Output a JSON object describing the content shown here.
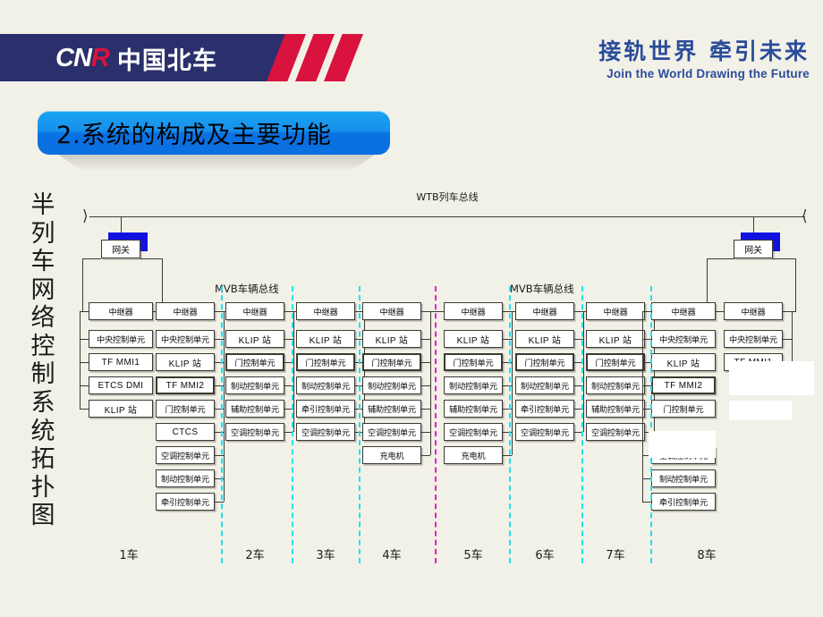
{
  "header": {
    "logo_mark": "CNR",
    "logo_mark_accent": "R",
    "logo_cn": "中国北车",
    "slogan_cn": "接轨世界  牵引未来",
    "slogan_en": "Join the World    Drawing the Future",
    "brand_navy": "#2b2f6b",
    "brand_red": "#d9123e",
    "slogan_color": "#2b4c9b"
  },
  "title": {
    "text": "2.系统的构成及主要功能",
    "accent": "#0b74e4"
  },
  "vertical_caption": "半列车网络控制系统拓扑图",
  "diagram": {
    "train_bus_label": "WTB列车总线",
    "vehicle_bus_label_left": "MVB车辆总线",
    "vehicle_bus_label_right": "MVB车辆总线",
    "gateway_label": "网关",
    "repeater_label": "中继器",
    "divider_color": "#19e3ef",
    "divider_color_mid": "#ef19c7",
    "car_labels": [
      "1车",
      "2车",
      "3车",
      "4车",
      "5车",
      "6车",
      "7车",
      "8车"
    ],
    "columns": [
      {
        "id": "c1a",
        "car": "1车",
        "repeater": "中继器",
        "units": [
          "中央控制单元",
          "TF MMI1",
          "ETCS DMI",
          "KLIP 站"
        ],
        "bold": []
      },
      {
        "id": "c1b",
        "car": "1车",
        "repeater": "中继器",
        "units": [
          "中央控制单元",
          "KLIP 站",
          "TF MMI2",
          "门控制单元",
          "CTCS",
          "空调控制单元",
          "制动控制单元",
          "牵引控制单元"
        ],
        "bold": [
          "TF MMI2"
        ]
      },
      {
        "id": "c2",
        "car": "2车",
        "repeater": "中继器",
        "units": [
          "KLIP 站",
          "门控制单元",
          "制动控制单元",
          "辅助控制单元",
          "空调控制单元"
        ],
        "bold": [
          "门控制单元"
        ]
      },
      {
        "id": "c3",
        "car": "3车",
        "repeater": "中继器",
        "units": [
          "KLIP 站",
          "门控制单元",
          "制动控制单元",
          "牵引控制单元",
          "空调控制单元"
        ],
        "bold": [
          "门控制单元"
        ]
      },
      {
        "id": "c4",
        "car": "4车",
        "repeater": "中继器",
        "units": [
          "KLIP 站",
          "门控制单元",
          "制动控制单元",
          "辅助控制单元",
          "空调控制单元",
          "充电机"
        ],
        "bold": [
          "门控制单元"
        ]
      },
      {
        "id": "c5",
        "car": "5车",
        "repeater": "中继器",
        "units": [
          "KLIP 站",
          "门控制单元",
          "制动控制单元",
          "辅助控制单元",
          "空调控制单元",
          "充电机"
        ],
        "bold": [
          "门控制单元"
        ]
      },
      {
        "id": "c6",
        "car": "6车",
        "repeater": "中继器",
        "units": [
          "KLIP 站",
          "门控制单元",
          "制动控制单元",
          "牵引控制单元",
          "空调控制单元"
        ],
        "bold": [
          "门控制单元"
        ]
      },
      {
        "id": "c7",
        "car": "7车",
        "repeater": "中继器",
        "units": [
          "KLIP 站",
          "门控制单元",
          "制动控制单元",
          "辅助控制单元",
          "空调控制单元"
        ],
        "bold": [
          "门控制单元"
        ]
      },
      {
        "id": "c8a",
        "car": "8车",
        "repeater": "中继器",
        "units": [
          "中央控制单元",
          "KLIP 站",
          "TF MMI2",
          "门控制单元",
          "",
          "空调控制单元",
          "制动控制单元",
          "牵引控制单元"
        ],
        "bold": [
          "TF MMI2"
        ]
      },
      {
        "id": "c8b",
        "car": "8车",
        "repeater": "中继器",
        "units": [
          "中央控制单元",
          "TF MMI1"
        ],
        "bold": []
      }
    ]
  }
}
